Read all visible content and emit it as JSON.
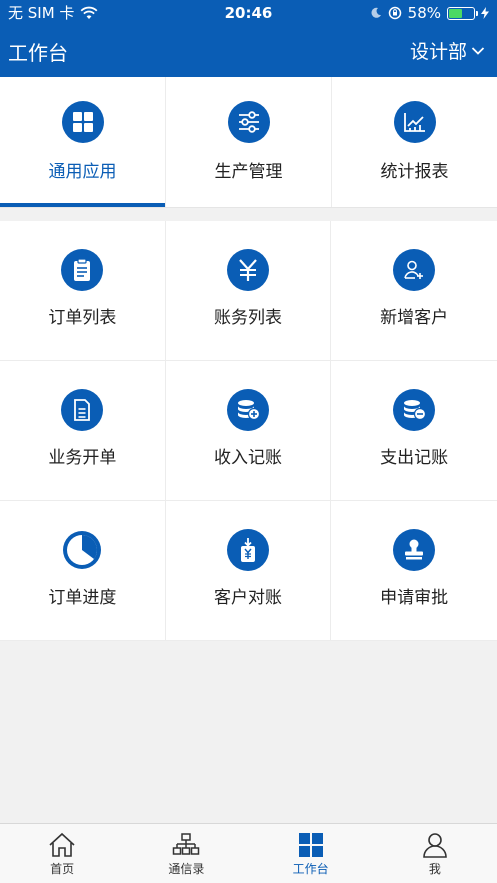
{
  "status_bar": {
    "carrier": "无 SIM 卡",
    "time": "20:46",
    "battery": "58%",
    "battery_level": 0.58
  },
  "nav": {
    "title": "工作台",
    "department": "设计部"
  },
  "tabs": [
    {
      "label": "通用应用",
      "icon": "grid-icon"
    },
    {
      "label": "生产管理",
      "icon": "sliders-icon"
    },
    {
      "label": "统计报表",
      "icon": "chart-icon"
    }
  ],
  "grid": [
    {
      "label": "订单列表",
      "icon": "clipboard-icon"
    },
    {
      "label": "账务列表",
      "icon": "yen-icon"
    },
    {
      "label": "新增客户",
      "icon": "add-user-icon"
    },
    {
      "label": "业务开单",
      "icon": "document-icon"
    },
    {
      "label": "收入记账",
      "icon": "coins-plus-icon"
    },
    {
      "label": "支出记账",
      "icon": "coins-minus-icon"
    },
    {
      "label": "订单进度",
      "icon": "pie-progress-icon"
    },
    {
      "label": "客户对账",
      "icon": "yen-receipt-icon"
    },
    {
      "label": "申请审批",
      "icon": "stamp-icon"
    }
  ],
  "tabbar": [
    {
      "label": "首页",
      "icon": "home-icon"
    },
    {
      "label": "通信录",
      "icon": "org-chart-icon"
    },
    {
      "label": "工作台",
      "icon": "workbench-icon"
    },
    {
      "label": "我",
      "icon": "person-icon"
    }
  ],
  "colors": {
    "primary": "#0a5db5",
    "battery": "#4cd964"
  }
}
